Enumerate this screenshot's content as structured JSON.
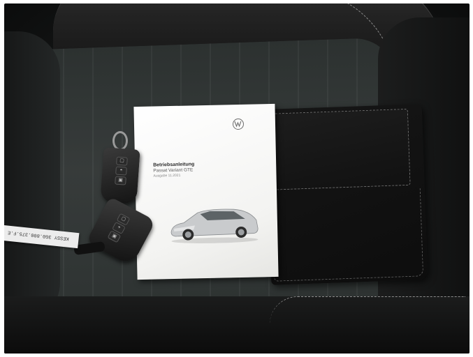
{
  "scene": {
    "description_colors": {
      "seat": "#333837",
      "leather": "#151515",
      "stitching": "#8d8d8d",
      "manual_paper": "#f5f5f3"
    }
  },
  "manual": {
    "logo": "vw-logo-icon",
    "title": "Betriebsanleitung",
    "subtitle": "Passat Variant GTE",
    "edition": "Ausgabe 11.2021"
  },
  "key_tag": {
    "text": "KESSY 3G0.800.375.F.E"
  },
  "wallet": {
    "icon": "leather-wallet"
  }
}
